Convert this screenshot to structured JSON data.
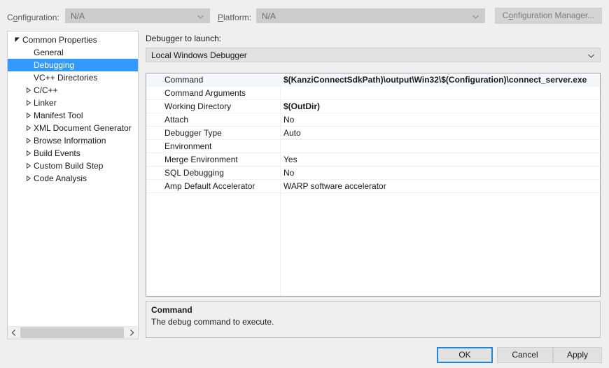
{
  "topbar": {
    "configuration_label_prefix": "C",
    "configuration_label_acc": "o",
    "configuration_label_suffix": "nfiguration:",
    "configuration_label": "Configuration:",
    "configuration_value": "N/A",
    "platform_label": "Platform:",
    "platform_label_acc": "P",
    "platform_label_suffix": "latform:",
    "platform_value": "N/A",
    "config_manager_prefix": "C",
    "config_manager_acc": "o",
    "config_manager_suffix": "nfiguration Manager..."
  },
  "tree": {
    "items": [
      {
        "label": "Common Properties",
        "indent": 0,
        "twisty": "expanded",
        "selected": false
      },
      {
        "label": "General",
        "indent": 1,
        "twisty": "none",
        "selected": false
      },
      {
        "label": "Debugging",
        "indent": 1,
        "twisty": "none",
        "selected": true
      },
      {
        "label": "VC++ Directories",
        "indent": 1,
        "twisty": "none",
        "selected": false
      },
      {
        "label": "C/C++",
        "indent": 1,
        "twisty": "collapsed",
        "selected": false
      },
      {
        "label": "Linker",
        "indent": 1,
        "twisty": "collapsed",
        "selected": false
      },
      {
        "label": "Manifest Tool",
        "indent": 1,
        "twisty": "collapsed",
        "selected": false
      },
      {
        "label": "XML Document Generator",
        "indent": 1,
        "twisty": "collapsed",
        "selected": false
      },
      {
        "label": "Browse Information",
        "indent": 1,
        "twisty": "collapsed",
        "selected": false
      },
      {
        "label": "Build Events",
        "indent": 1,
        "twisty": "collapsed",
        "selected": false
      },
      {
        "label": "Custom Build Step",
        "indent": 1,
        "twisty": "collapsed",
        "selected": false
      },
      {
        "label": "Code Analysis",
        "indent": 1,
        "twisty": "collapsed",
        "selected": false
      }
    ]
  },
  "right": {
    "debugger_to_launch_label": "Debugger to launch:",
    "debugger_selected": "Local Windows Debugger",
    "grid": {
      "rows": [
        {
          "name": "Command",
          "value": "$(KanziConnectSdkPath)\\output\\Win32\\$(Configuration)\\connect_server.exe",
          "bold": true
        },
        {
          "name": "Command Arguments",
          "value": "",
          "bold": false
        },
        {
          "name": "Working Directory",
          "value": "$(OutDir)",
          "bold": true
        },
        {
          "name": "Attach",
          "value": "No",
          "bold": false
        },
        {
          "name": "Debugger Type",
          "value": "Auto",
          "bold": false
        },
        {
          "name": "Environment",
          "value": "",
          "bold": false
        },
        {
          "name": "Merge Environment",
          "value": "Yes",
          "bold": false
        },
        {
          "name": "SQL Debugging",
          "value": "No",
          "bold": false
        },
        {
          "name": "Amp Default Accelerator",
          "value": "WARP software accelerator",
          "bold": false
        }
      ]
    },
    "description": {
      "title": "Command",
      "text": "The debug command to execute."
    }
  },
  "buttons": {
    "ok": "OK",
    "cancel": "Cancel",
    "apply": "Apply"
  },
  "colors": {
    "selection_blue": "#3399ff",
    "default_button_border": "#1e87dd",
    "dialog_background": "#efeff0"
  }
}
